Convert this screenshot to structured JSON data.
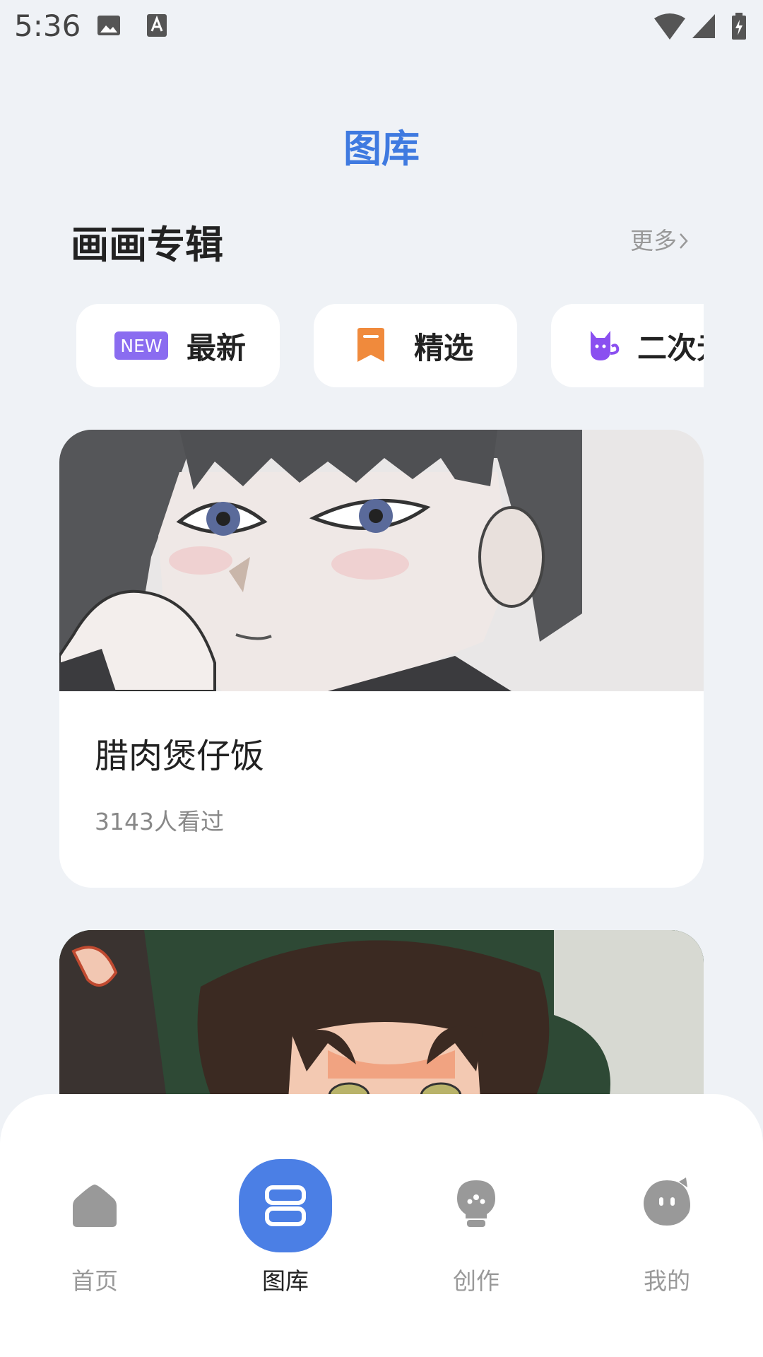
{
  "status_bar": {
    "time": "5:36"
  },
  "page": {
    "title": "图库"
  },
  "section": {
    "title": "画画专辑",
    "more_label": "更多"
  },
  "categories": [
    {
      "label": "最新",
      "badge": "NEW",
      "icon": "new-badge-icon",
      "badge_color": "#8a6cf0"
    },
    {
      "label": "精选",
      "icon": "bookmark-icon",
      "icon_color": "#f08a3c"
    },
    {
      "label": "二次元",
      "icon": "cat-icon",
      "icon_color": "#8a4ff0"
    }
  ],
  "albums": [
    {
      "title": "腊肉煲仔饭",
      "views": "3143人看过"
    },
    {
      "title": ""
    }
  ],
  "bottom_nav": {
    "items": [
      {
        "label": "首页",
        "icon": "home-icon",
        "active": false
      },
      {
        "label": "图库",
        "icon": "gallery-icon",
        "active": true
      },
      {
        "label": "创作",
        "icon": "bulb-icon",
        "active": false
      },
      {
        "label": "我的",
        "icon": "profile-face-icon",
        "active": false
      }
    ],
    "accent": "#4b7fe5"
  }
}
